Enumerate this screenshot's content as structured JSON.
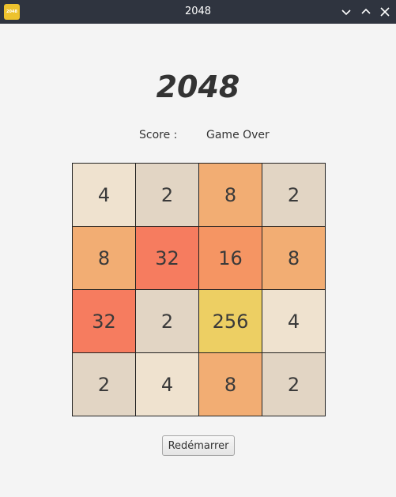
{
  "window": {
    "title": "2048",
    "icon_text": "2048",
    "icon_color": "#edc22e",
    "titlebar_color": "#2f343f"
  },
  "header": {
    "title": "2048",
    "score_label": "Score :",
    "status": "Game Over"
  },
  "board": {
    "rows": [
      [
        {
          "value": "4",
          "color": "#efe2cf"
        },
        {
          "value": "2",
          "color": "#e2d5c4"
        },
        {
          "value": "8",
          "color": "#f2ad73"
        },
        {
          "value": "2",
          "color": "#e2d5c4"
        }
      ],
      [
        {
          "value": "8",
          "color": "#f2ad73"
        },
        {
          "value": "32",
          "color": "#f67c5f"
        },
        {
          "value": "16",
          "color": "#f59563"
        },
        {
          "value": "8",
          "color": "#f2ad73"
        }
      ],
      [
        {
          "value": "32",
          "color": "#f67c5f"
        },
        {
          "value": "2",
          "color": "#e2d5c4"
        },
        {
          "value": "256",
          "color": "#edcf63"
        },
        {
          "value": "4",
          "color": "#efe2cf"
        }
      ],
      [
        {
          "value": "2",
          "color": "#e2d5c4"
        },
        {
          "value": "4",
          "color": "#efe2cf"
        },
        {
          "value": "8",
          "color": "#f2ad73"
        },
        {
          "value": "2",
          "color": "#e2d5c4"
        }
      ]
    ]
  },
  "controls": {
    "restart_label": "Redémarrer"
  }
}
